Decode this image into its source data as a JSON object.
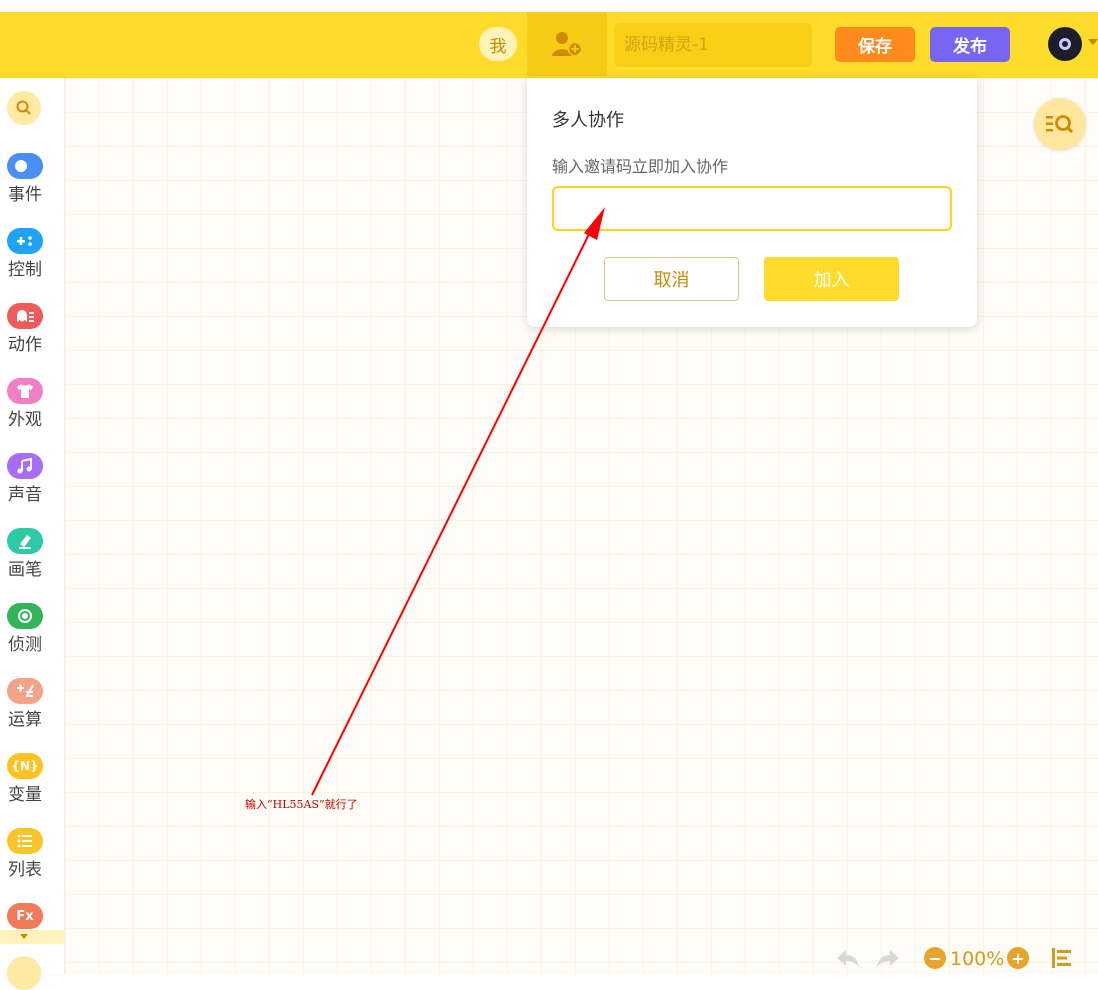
{
  "header": {
    "me_label": "我",
    "collab_icon": "add-user-icon",
    "project_name_placeholder": "源码精灵-1",
    "save_label": "保存",
    "publish_label": "发布",
    "avatar_icon": "user-avatar"
  },
  "sidebar": {
    "search_icon": "search-icon",
    "categories": [
      {
        "label": "事件",
        "color": "#4a8ff5",
        "icon": "toggle-icon"
      },
      {
        "label": "控制",
        "color": "#1fa3f5",
        "icon": "gamepad-icon"
      },
      {
        "label": "动作",
        "color": "#f05a5a",
        "icon": "ghost-icon"
      },
      {
        "label": "外观",
        "color": "#f27ec6",
        "icon": "shirt-icon"
      },
      {
        "label": "声音",
        "color": "#a66ef5",
        "icon": "music-icon"
      },
      {
        "label": "画笔",
        "color": "#2ec9a6",
        "icon": "pen-icon"
      },
      {
        "label": "侦测",
        "color": "#33b35a",
        "icon": "target-icon"
      },
      {
        "label": "运算",
        "color": "#f2a38a",
        "icon": "calc-icon"
      },
      {
        "label": "变量",
        "color": "#ffc21f",
        "icon": "variable-icon",
        "glyph": "{N}"
      },
      {
        "label": "列表",
        "color": "#f7c528",
        "icon": "list-icon"
      },
      {
        "label": "",
        "color": "#f07a5a",
        "icon": "function-icon",
        "glyph": "Fx"
      }
    ]
  },
  "popup": {
    "title": "多人协作",
    "subtitle": "输入邀请码立即加入协作",
    "input_value": "",
    "cancel_label": "取消",
    "join_label": "加入"
  },
  "annotation": {
    "text": "输入“HL55AS”就行了",
    "color": "#cc0000"
  },
  "bottom_toolbar": {
    "zoom_level": "100%",
    "zoom_out_glyph": "−",
    "zoom_in_glyph": "+"
  },
  "colors": {
    "header_bg": "#ffdb2b",
    "save_btn": "#ff8a1d",
    "publish_btn": "#7866f2",
    "accent": "#ffd21f"
  }
}
